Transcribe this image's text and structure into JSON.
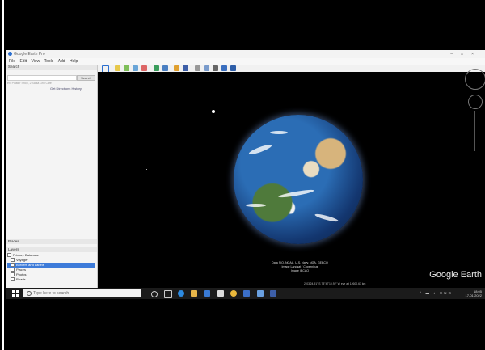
{
  "window": {
    "title": "Google Earth Pro"
  },
  "menu": [
    "File",
    "Edit",
    "View",
    "Tools",
    "Add",
    "Help"
  ],
  "sidebar": {
    "search_header": "Search",
    "search_button": "Search",
    "search_hint": "ex: Plaster Shop, 2 Salsa Grill Cafe",
    "search_link": "Get Directions  History",
    "places_header": "Places",
    "layers_header": "Layers",
    "layers": [
      {
        "label": "Primary Database",
        "selected": false
      },
      {
        "label": "Voyager",
        "selected": false
      },
      {
        "label": "Borders and Labels",
        "selected": true
      },
      {
        "label": "Places",
        "selected": false
      },
      {
        "label": "Photos",
        "selected": false
      },
      {
        "label": "Roads",
        "selected": false
      }
    ]
  },
  "viewport": {
    "credits": [
      "Data SIO, NOAA, U.S. Navy, NGA, GEBCO",
      "Image Landsat / Copernicus",
      "Image IBCAO"
    ],
    "logo": "Google Earth",
    "status": "2°03'24.91\" S  73°47'10.92\" W  eye alt 12600.63 km"
  },
  "taskbar": {
    "search_placeholder": "Type here to search",
    "time": "18:05",
    "date": "17-01-2022"
  }
}
